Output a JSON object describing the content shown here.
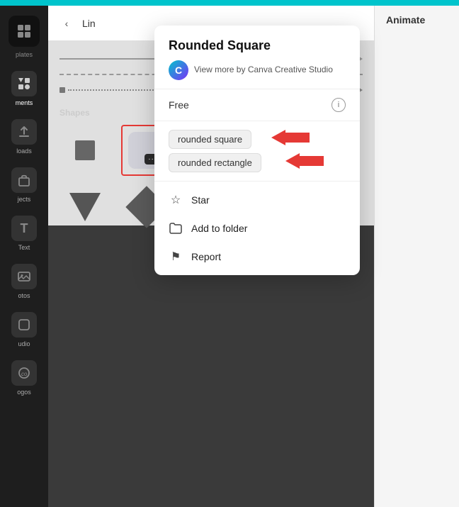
{
  "topBar": {
    "color": "#00c4cc"
  },
  "sidebar": {
    "items": [
      {
        "id": "plates",
        "label": "plates",
        "icon": "⊞"
      },
      {
        "id": "elements",
        "label": "ments",
        "icon": "△□"
      },
      {
        "id": "uploads",
        "label": "loads",
        "icon": "⬆"
      },
      {
        "id": "objects",
        "label": "jects",
        "icon": "📁"
      },
      {
        "id": "text",
        "label": "Text",
        "icon": "T"
      },
      {
        "id": "photos",
        "label": "otos",
        "icon": "🖼"
      },
      {
        "id": "studio",
        "label": "udio",
        "icon": "◻"
      },
      {
        "id": "logos",
        "label": "ogos",
        "icon": "©"
      }
    ]
  },
  "toolbar": {
    "backLabel": "‹",
    "title": "Lin"
  },
  "rightPanel": {
    "animateLabel": "Animate"
  },
  "shapesSection": {
    "label": "Shapes"
  },
  "popup": {
    "title": "Rounded Square",
    "brandName": "Canva Creative Studio",
    "brandViewMore": "View more by",
    "brandIcon": "C",
    "freeLabel": "Free",
    "infoIcon": "i",
    "tag1": "rounded square",
    "tag2": "rounded rectangle",
    "menuItems": [
      {
        "id": "star",
        "label": "Star",
        "icon": "☆"
      },
      {
        "id": "add-to-folder",
        "label": "Add to folder",
        "icon": "🗂"
      },
      {
        "id": "report",
        "label": "Report",
        "icon": "⚑"
      }
    ]
  }
}
